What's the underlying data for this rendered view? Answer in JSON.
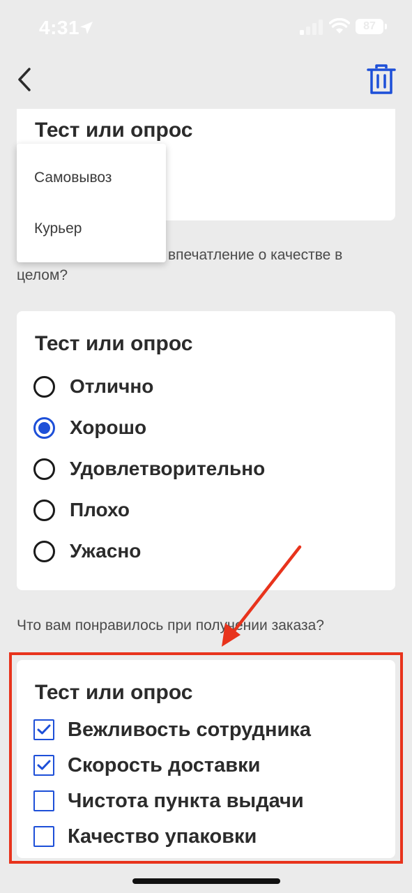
{
  "status_bar": {
    "time": "4:31",
    "battery": "87"
  },
  "colors": {
    "accent": "#1d4fd8",
    "annotation": "#e8331c",
    "background": "#ebebeb"
  },
  "icons": {
    "back": "chevron-left-icon",
    "trash": "trash-icon"
  },
  "card1": {
    "title": "Тест или опрос"
  },
  "dropdown": {
    "options": [
      "Самовывоз",
      "Курьер"
    ]
  },
  "question1": {
    "visible_text": "впечатление о качестве в целом?"
  },
  "card2": {
    "title": "Тест или опрос",
    "options": [
      {
        "label": "Отлично",
        "selected": false
      },
      {
        "label": "Хорошо",
        "selected": true
      },
      {
        "label": "Удовлетворительно",
        "selected": false
      },
      {
        "label": "Плохо",
        "selected": false
      },
      {
        "label": "Ужасно",
        "selected": false
      }
    ]
  },
  "question2": {
    "text": "Что вам понравилось при получении заказа?"
  },
  "card3": {
    "title": "Тест или опрос",
    "options": [
      {
        "label": "Вежливость сотрудника",
        "checked": true
      },
      {
        "label": "Скорость доставки",
        "checked": true
      },
      {
        "label": "Чистота пункта выдачи",
        "checked": false
      },
      {
        "label": "Качество упаковки",
        "checked": false
      }
    ]
  }
}
